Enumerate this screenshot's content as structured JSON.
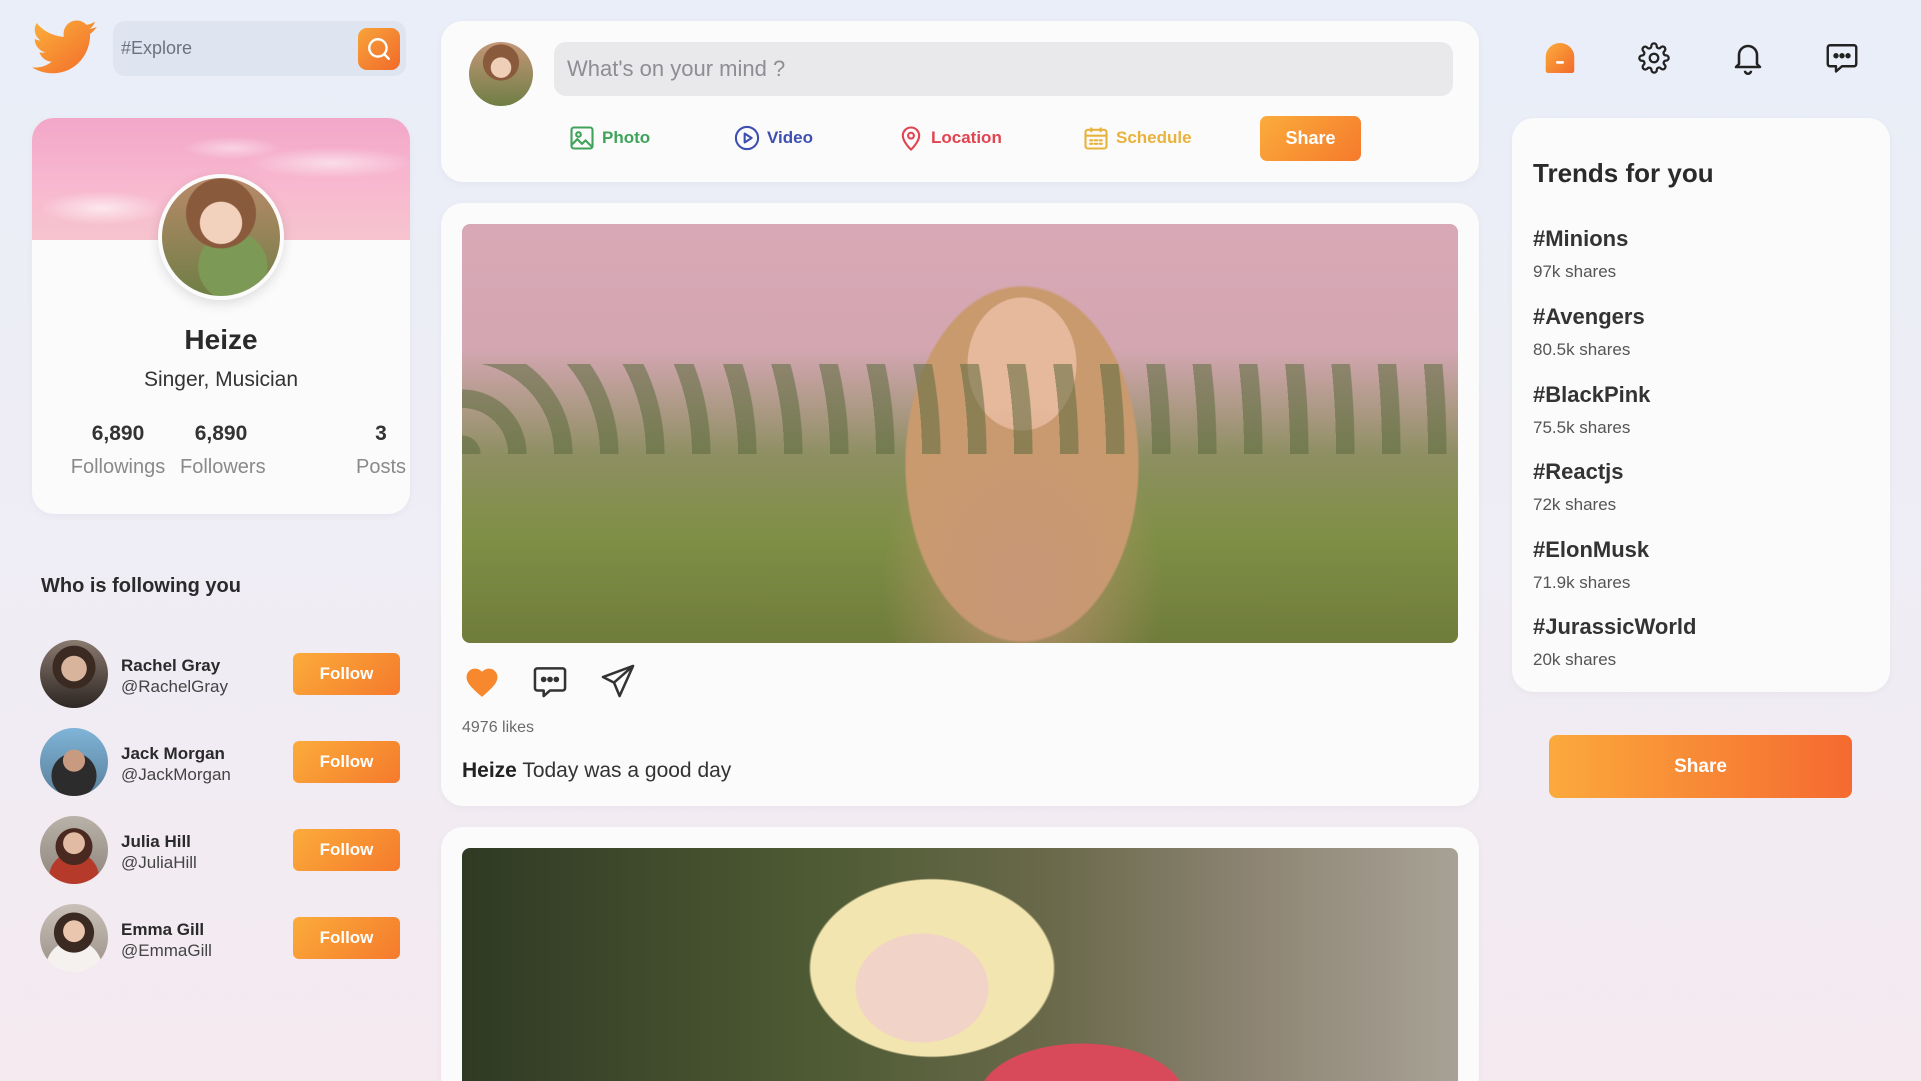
{
  "search": {
    "placeholder": "#Explore"
  },
  "profile": {
    "name": "Heize",
    "role": "Singer, Musician",
    "stats": [
      {
        "value": "6,890",
        "label": "Followings"
      },
      {
        "value": "6,890",
        "label": "Followers"
      },
      {
        "value": "3",
        "label": "Posts"
      }
    ]
  },
  "followers": {
    "title": "Who is following you",
    "button_label": "Follow",
    "items": [
      {
        "name": "Rachel Gray",
        "handle": "@RachelGray"
      },
      {
        "name": "Jack Morgan",
        "handle": "@JackMorgan"
      },
      {
        "name": "Julia Hill",
        "handle": "@JuliaHill"
      },
      {
        "name": "Emma Gill",
        "handle": "@EmmaGill"
      }
    ]
  },
  "composer": {
    "placeholder": "What's on your mind ?",
    "actions": [
      {
        "label": "Photo",
        "icon": "photo-icon",
        "color": "#3fa35a"
      },
      {
        "label": "Video",
        "icon": "play-circle-icon",
        "color": "#3e4fb0"
      },
      {
        "label": "Location",
        "icon": "location-pin-icon",
        "color": "#e0444f"
      },
      {
        "label": "Schedule",
        "icon": "calendar-icon",
        "color": "#e8b33c"
      }
    ],
    "share_label": "Share"
  },
  "post": {
    "likes": "4976 likes",
    "author": "Heize",
    "caption": "Today was a good day"
  },
  "trends": {
    "title": "Trends for you",
    "items": [
      {
        "tag": "#Minions",
        "shares": "97k shares"
      },
      {
        "tag": "#Avengers",
        "shares": "80.5k shares"
      },
      {
        "tag": "#BlackPink",
        "shares": "75.5k shares"
      },
      {
        "tag": "#Reactjs",
        "shares": "72k shares"
      },
      {
        "tag": "#ElonMusk",
        "shares": "71.9k shares"
      },
      {
        "tag": "#JurassicWorld",
        "shares": "20k shares"
      }
    ]
  },
  "share_button": "Share",
  "colors": {
    "accent": "#f58a2c",
    "heart": "#f7882e"
  }
}
